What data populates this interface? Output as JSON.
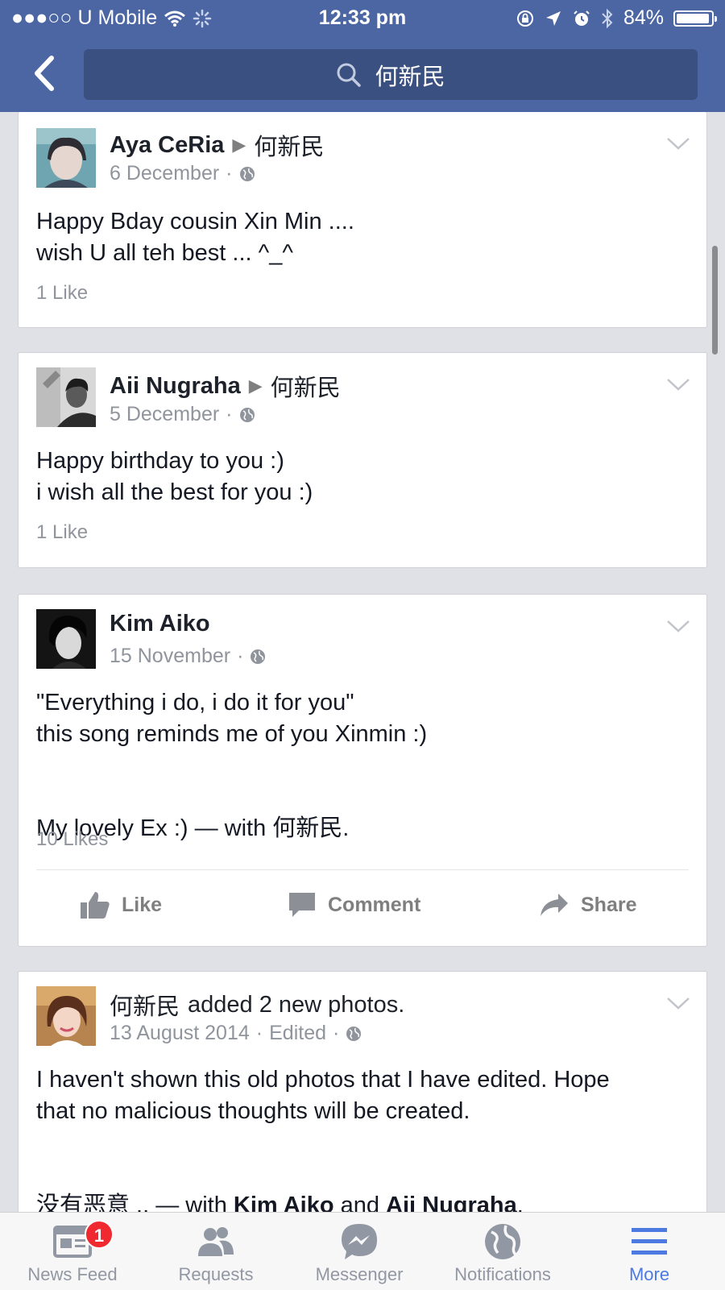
{
  "status_bar": {
    "carrier": "●●●○○ U Mobile",
    "time": "12:33 pm",
    "battery": "84%",
    "battery_level": 0.84
  },
  "header": {
    "search_query": "何新民"
  },
  "posts": [
    {
      "author": "Aya CeRia",
      "target": "何新民",
      "date": "6 December",
      "text": "Happy Bday cousin Xin Min ....\nwish U all teh best ... ^_^",
      "likes": "1 Like"
    },
    {
      "author": "Aii Nugraha",
      "target": "何新民",
      "date": "5 December",
      "text": "Happy birthday to you :)\ni wish all the best for you :)",
      "likes": "1 Like"
    },
    {
      "author": "Kim Aiko",
      "date": "15 November",
      "text_line1": "\"Everything i do, i do it for you\"",
      "text_line2": "this song reminds me of you Xinmin :)",
      "text_line3": "My lovely Ex :) — with ",
      "with_name": "何新民",
      "text_end": ".",
      "likes": "10 Likes",
      "actions": {
        "like": "Like",
        "comment": "Comment",
        "share": "Share"
      }
    },
    {
      "author": "何新民",
      "action_text": "added 2 new photos.",
      "date": "13 August 2014",
      "edited": "Edited",
      "text": "I haven't shown this old photos that I have edited. Hope\nthat no malicious thoughts will be created.",
      "line3_start": "没有恶意 .. — with ",
      "with1": "Kim Aiko",
      "and": " and ",
      "with2": "Aii Nugraha",
      "end": "."
    }
  ],
  "tabbar": {
    "tabs": [
      {
        "label": "News Feed",
        "icon": "news-feed-icon",
        "badge": "1"
      },
      {
        "label": "Requests",
        "icon": "requests-icon"
      },
      {
        "label": "Messenger",
        "icon": "messenger-icon"
      },
      {
        "label": "Notifications",
        "icon": "globe-icon"
      },
      {
        "label": "More",
        "icon": "menu-icon",
        "active": true
      }
    ]
  },
  "colors": {
    "header": "#4c66a4",
    "active_tab": "#4c7ae0",
    "badge": "#f02830"
  }
}
